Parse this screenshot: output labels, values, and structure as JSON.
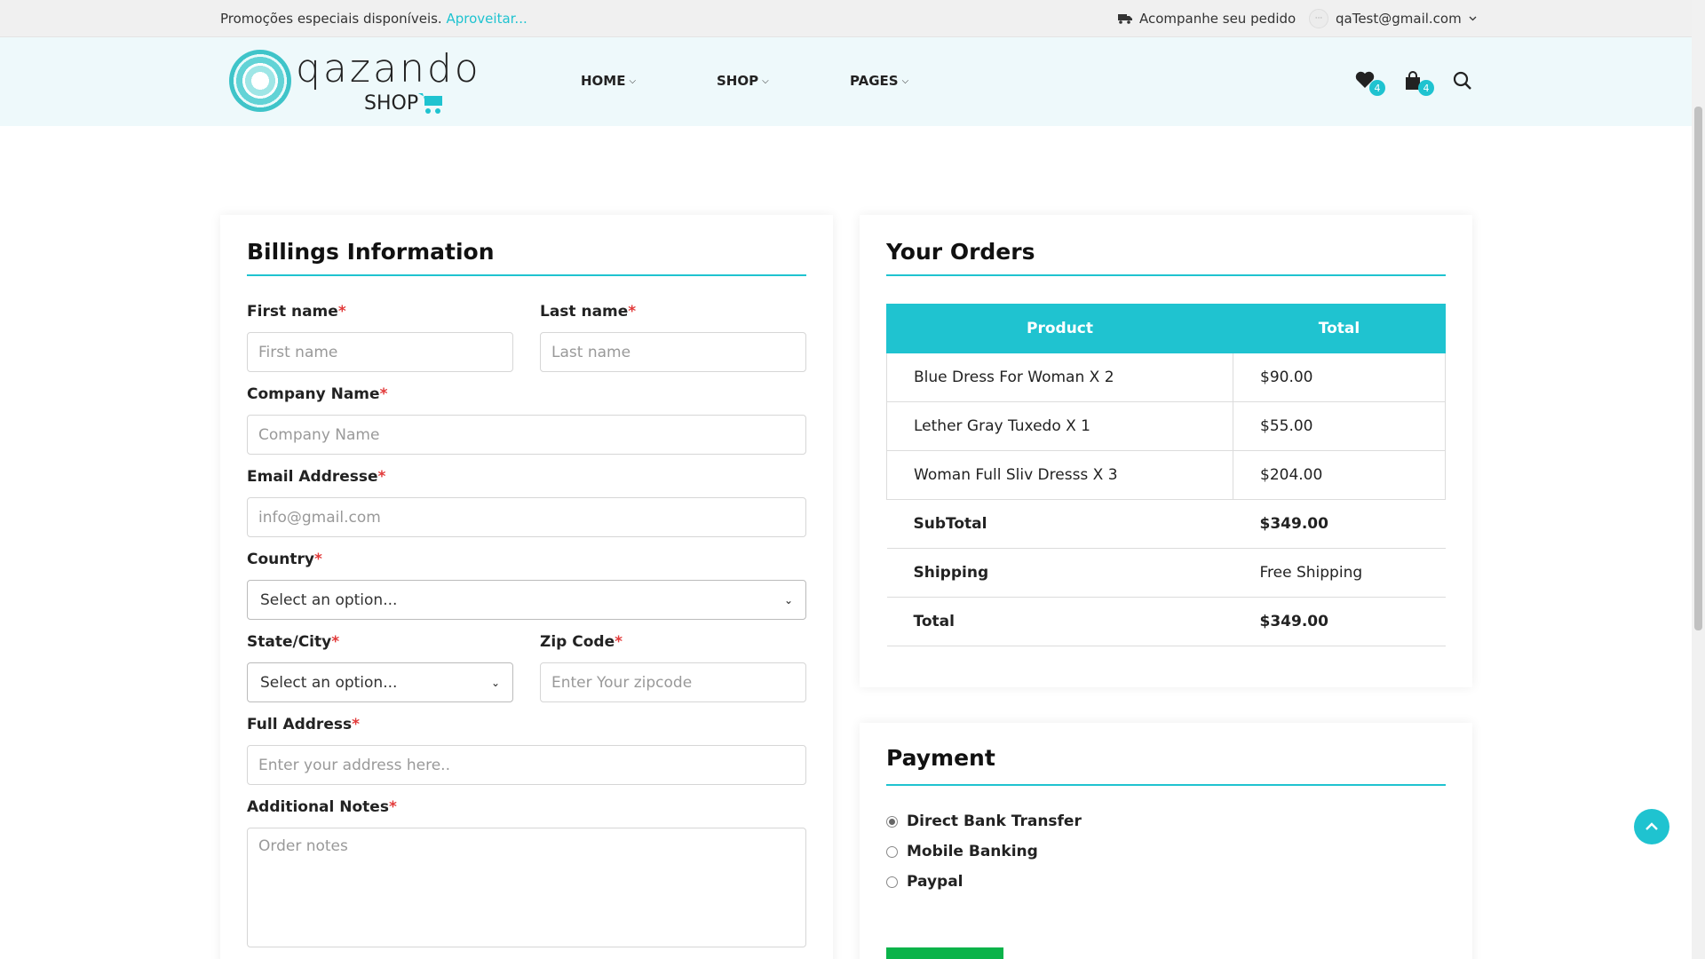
{
  "topbar": {
    "promo_text": "Promoções especiais disponíveis.",
    "promo_link": "Aproveitar...",
    "track_order": "Acompanhe seu pedido",
    "user_email": "qaTest@gmail.com"
  },
  "header": {
    "logo_text": "qazando",
    "logo_sub": "SHOP",
    "nav": [
      {
        "label": "HOME"
      },
      {
        "label": "SHOP"
      },
      {
        "label": "PAGES"
      }
    ],
    "wishlist_count": "4",
    "cart_count": "4"
  },
  "billing": {
    "title": "Billings Information",
    "first_name": {
      "label": "First name",
      "placeholder": "First name"
    },
    "last_name": {
      "label": "Last name",
      "placeholder": "Last name"
    },
    "company": {
      "label": "Company Name",
      "placeholder": "Company Name"
    },
    "email": {
      "label": "Email Addresse",
      "placeholder": "info@gmail.com"
    },
    "country": {
      "label": "Country",
      "value": "Select an option..."
    },
    "state": {
      "label": "State/City",
      "value": "Select an option..."
    },
    "zip": {
      "label": "Zip Code",
      "placeholder": "Enter Your zipcode"
    },
    "address": {
      "label": "Full Address",
      "placeholder": "Enter your address here.."
    },
    "notes": {
      "label": "Additional Notes",
      "placeholder": "Order notes"
    },
    "required_mark": "*"
  },
  "orders": {
    "title": "Your Orders",
    "headers": [
      "Product",
      "Total"
    ],
    "items": [
      {
        "product": "Blue Dress For Woman X 2",
        "total": "$90.00"
      },
      {
        "product": "Lether Gray Tuxedo X 1",
        "total": "$55.00"
      },
      {
        "product": "Woman Full Sliv Dresss X 3",
        "total": "$204.00"
      }
    ],
    "subtotal_label": "SubTotal",
    "subtotal_value": "$349.00",
    "shipping_label": "Shipping",
    "shipping_value": "Free Shipping",
    "total_label": "Total",
    "total_value": "$349.00"
  },
  "payment": {
    "title": "Payment",
    "options": [
      "Direct Bank Transfer",
      "Mobile Banking",
      "Paypal"
    ],
    "selected": "Direct Bank Transfer"
  },
  "colors": {
    "accent": "#1fc3d0",
    "required": "#e23a3a",
    "header_bg": "#eef9fb"
  }
}
